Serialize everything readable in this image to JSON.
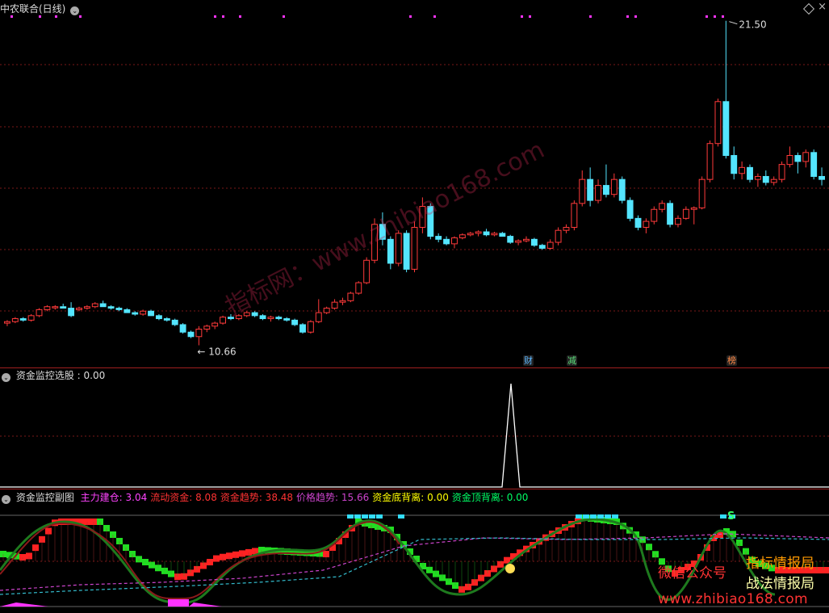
{
  "main_panel": {
    "title": "中农联合(日线)",
    "high_label": "21.50",
    "low_label": "10.66",
    "markers": [
      {
        "text": "财",
        "color": "#5bb6ff"
      },
      {
        "text": "减",
        "color": "#5be07a"
      },
      {
        "text": "榜",
        "color": "#ff8844"
      }
    ]
  },
  "panel2": {
    "title": "资金监控选股",
    "value_text": ": 0.00"
  },
  "panel3": {
    "title": "资金监控副图",
    "indicators": [
      {
        "name": "主力建仓",
        "value": "3.04",
        "color": "#ff44ff"
      },
      {
        "name": "流动资金",
        "value": "8.08",
        "color": "#ff3333"
      },
      {
        "name": "资金趋势",
        "value": "38.48",
        "color": "#ff3333"
      },
      {
        "name": "价格趋势",
        "value": "15.66",
        "color": "#cc44cc"
      },
      {
        "name": "资金底背离",
        "value": "0.00",
        "color": "#ffff00"
      },
      {
        "name": "资金顶背离",
        "value": "0.00",
        "color": "#00ff66"
      }
    ],
    "s_marker": "S"
  },
  "watermarks": {
    "diagonal": "指标网：www.zhibiao168.com",
    "wechat": "微信公众号",
    "brand1": "指标情报局",
    "brand2": "战法情报局",
    "url": "www.zhibiao168.com"
  },
  "colors": {
    "up": "#ff3a3a",
    "down": "#54e5ff",
    "grid": "#7a1818",
    "separator": "#a02020"
  },
  "chart_data": {
    "type": "candlestick",
    "note_units": "price in CNY",
    "ylim": [
      10.0,
      21.8
    ],
    "candles": [
      [
        11.4,
        11.5,
        11.3,
        11.45
      ],
      [
        11.45,
        11.6,
        11.4,
        11.55
      ],
      [
        11.55,
        11.6,
        11.45,
        11.5
      ],
      [
        11.5,
        11.7,
        11.45,
        11.65
      ],
      [
        11.65,
        11.9,
        11.6,
        11.85
      ],
      [
        11.85,
        12.0,
        11.8,
        11.95
      ],
      [
        11.95,
        12.0,
        11.85,
        11.95
      ],
      [
        11.95,
        12.05,
        11.9,
        11.9
      ],
      [
        11.9,
        12.1,
        11.6,
        11.65
      ],
      [
        11.85,
        11.95,
        11.8,
        11.9
      ],
      [
        11.9,
        12.0,
        11.85,
        11.95
      ],
      [
        11.95,
        12.1,
        11.9,
        12.05
      ],
      [
        12.05,
        12.15,
        11.95,
        11.95
      ],
      [
        11.95,
        12.0,
        11.85,
        11.9
      ],
      [
        11.9,
        11.95,
        11.8,
        11.85
      ],
      [
        11.85,
        11.9,
        11.75,
        11.75
      ],
      [
        11.75,
        11.8,
        11.65,
        11.7
      ],
      [
        11.7,
        11.85,
        11.65,
        11.8
      ],
      [
        11.8,
        11.85,
        11.65,
        11.65
      ],
      [
        11.65,
        11.7,
        11.5,
        11.55
      ],
      [
        11.55,
        11.6,
        11.45,
        11.5
      ],
      [
        11.5,
        11.55,
        11.3,
        11.35
      ],
      [
        11.35,
        11.4,
        11.05,
        11.1
      ],
      [
        11.1,
        11.15,
        10.9,
        10.95
      ],
      [
        10.95,
        11.3,
        10.66,
        11.2
      ],
      [
        11.2,
        11.35,
        11.1,
        11.3
      ],
      [
        11.3,
        11.45,
        11.2,
        11.4
      ],
      [
        11.4,
        11.65,
        11.35,
        11.6
      ],
      [
        11.6,
        11.7,
        11.5,
        11.55
      ],
      [
        11.55,
        11.7,
        11.5,
        11.65
      ],
      [
        11.65,
        11.8,
        11.6,
        11.75
      ],
      [
        11.75,
        11.8,
        11.6,
        11.65
      ],
      [
        11.65,
        11.7,
        11.5,
        11.55
      ],
      [
        11.55,
        11.65,
        11.45,
        11.6
      ],
      [
        11.6,
        11.65,
        11.5,
        11.55
      ],
      [
        11.55,
        11.6,
        11.45,
        11.5
      ],
      [
        11.5,
        11.55,
        11.3,
        11.35
      ],
      [
        11.35,
        11.4,
        11.05,
        11.1
      ],
      [
        11.1,
        11.5,
        11.05,
        11.45
      ],
      [
        11.45,
        12.2,
        11.4,
        11.75
      ],
      [
        11.75,
        11.95,
        11.7,
        11.9
      ],
      [
        11.9,
        12.2,
        11.85,
        12.1
      ],
      [
        12.1,
        12.25,
        12.0,
        12.15
      ],
      [
        12.15,
        12.45,
        12.1,
        12.4
      ],
      [
        12.4,
        12.8,
        12.35,
        12.75
      ],
      [
        12.75,
        13.6,
        12.7,
        13.5
      ],
      [
        13.5,
        14.9,
        13.4,
        14.7
      ],
      [
        14.7,
        15.1,
        14.0,
        14.2
      ],
      [
        14.2,
        14.3,
        13.2,
        13.4
      ],
      [
        13.4,
        14.5,
        13.3,
        14.4
      ],
      [
        14.4,
        14.5,
        13.1,
        13.2
      ],
      [
        13.2,
        14.8,
        13.1,
        14.6
      ],
      [
        14.6,
        15.6,
        14.4,
        15.3
      ],
      [
        15.3,
        15.4,
        14.2,
        14.3
      ],
      [
        14.3,
        14.4,
        14.1,
        14.2
      ],
      [
        14.2,
        14.3,
        14.0,
        14.05
      ],
      [
        14.05,
        14.3,
        13.9,
        14.25
      ],
      [
        14.25,
        14.4,
        14.2,
        14.35
      ],
      [
        14.35,
        14.45,
        14.3,
        14.4
      ],
      [
        14.4,
        14.5,
        14.3,
        14.45
      ],
      [
        14.45,
        14.55,
        14.3,
        14.35
      ],
      [
        14.35,
        14.45,
        14.3,
        14.4
      ],
      [
        14.4,
        14.45,
        14.3,
        14.3
      ],
      [
        14.3,
        14.35,
        14.05,
        14.1
      ],
      [
        14.1,
        14.2,
        14.0,
        14.15
      ],
      [
        14.15,
        14.3,
        14.1,
        14.2
      ],
      [
        14.2,
        14.25,
        13.95,
        14.0
      ],
      [
        14.0,
        14.05,
        13.85,
        13.9
      ],
      [
        13.9,
        14.2,
        13.85,
        14.1
      ],
      [
        14.1,
        14.6,
        14.0,
        14.5
      ],
      [
        14.5,
        14.7,
        14.4,
        14.6
      ],
      [
        14.6,
        15.5,
        14.5,
        15.4
      ],
      [
        15.4,
        16.5,
        15.3,
        16.2
      ],
      [
        16.2,
        16.6,
        15.3,
        15.5
      ],
      [
        15.5,
        16.2,
        15.4,
        16.0
      ],
      [
        16.0,
        16.7,
        15.6,
        15.7
      ],
      [
        15.7,
        16.4,
        15.6,
        16.2
      ],
      [
        16.2,
        16.3,
        15.4,
        15.5
      ],
      [
        15.5,
        15.6,
        14.8,
        14.9
      ],
      [
        14.9,
        15.0,
        14.5,
        14.6
      ],
      [
        14.6,
        14.9,
        14.4,
        14.8
      ],
      [
        14.8,
        15.3,
        14.7,
        15.2
      ],
      [
        15.2,
        15.5,
        15.1,
        15.4
      ],
      [
        15.4,
        15.5,
        14.6,
        14.7
      ],
      [
        14.7,
        15.0,
        14.6,
        14.9
      ],
      [
        14.9,
        15.3,
        14.85,
        15.2
      ],
      [
        15.2,
        15.3,
        14.7,
        15.25
      ],
      [
        15.25,
        16.3,
        15.2,
        16.2
      ],
      [
        16.2,
        17.5,
        16.1,
        17.4
      ],
      [
        17.4,
        18.9,
        17.3,
        18.8
      ],
      [
        18.8,
        21.5,
        16.9,
        17.0
      ],
      [
        17.0,
        17.3,
        16.2,
        16.4
      ],
      [
        16.4,
        16.8,
        16.2,
        16.6
      ],
      [
        16.6,
        16.7,
        16.1,
        16.2
      ],
      [
        16.2,
        16.4,
        15.95,
        16.3
      ],
      [
        16.3,
        16.5,
        16.0,
        16.1
      ],
      [
        16.1,
        16.3,
        16.0,
        16.2
      ],
      [
        16.2,
        16.8,
        16.1,
        16.7
      ],
      [
        16.7,
        17.3,
        16.6,
        17.0
      ],
      [
        17.0,
        17.1,
        16.4,
        16.8
      ],
      [
        16.8,
        17.2,
        16.6,
        17.1
      ],
      [
        17.1,
        17.2,
        16.2,
        16.3
      ],
      [
        16.3,
        16.6,
        16.0,
        16.2
      ]
    ]
  }
}
